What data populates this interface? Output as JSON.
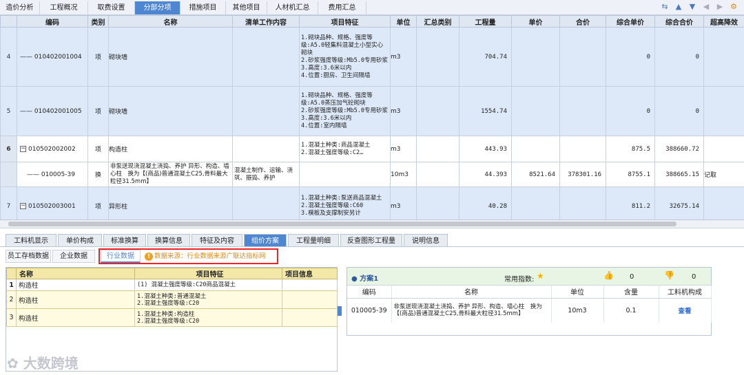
{
  "top_tabs": [
    {
      "label": "造价分析"
    },
    {
      "label": "工程概况"
    },
    {
      "label": "取费设置"
    },
    {
      "label": "分部分项",
      "active": true
    },
    {
      "label": "措施项目"
    },
    {
      "label": "其他项目"
    },
    {
      "label": "人材机汇总"
    },
    {
      "label": "费用汇总"
    }
  ],
  "columns": [
    "编码",
    "类别",
    "名称",
    "清单工作内容",
    "项目特征",
    "单位",
    "汇总类别",
    "工程量",
    "单价",
    "合价",
    "综合单价",
    "综合合价",
    "超高降效"
  ],
  "rows": [
    {
      "no": "4",
      "code": "010402001004",
      "type": "项",
      "name": "砌块墙",
      "work": "",
      "feat": "1.砌块品种、规格、强度等级:A5.0轻集料混凝土小型实心砌块\n2.砂浆强度等级:Mb5.0专用砂浆\n3.高度:3.6米以内\n4.位置:厨房、卫生间隔墙",
      "unit": "m3",
      "qty": "704.74",
      "price": "",
      "total": "",
      "cprice": "0",
      "ctotal": "0",
      "extra": ""
    },
    {
      "no": "5",
      "code": "010402001005",
      "type": "项",
      "name": "砌块墙",
      "work": "",
      "feat": "1.砌块品种、规格、强度等级:A5.0蒸压加气砼砌块\n2.砂浆强度等级:Mb5.0专用砂浆\n3.高度:3.6米以内\n4.位置:室内隔墙",
      "unit": "m3",
      "qty": "1554.74",
      "price": "",
      "total": "",
      "cprice": "0",
      "ctotal": "0",
      "extra": ""
    },
    {
      "no": "6",
      "code": "010502002002",
      "type": "项",
      "name": "构造柱",
      "work": "",
      "feat": "1.混凝土种类:商品混凝土\n2.混凝土强度等级:C2…",
      "unit": "m3",
      "qty": "443.93",
      "price": "",
      "total": "",
      "cprice": "875.5",
      "ctotal": "388660.72",
      "extra": ""
    },
    {
      "no": "",
      "code": "010005-39",
      "type": "换",
      "name": "非泵送现浇混凝土浇捣、养护 异形、构造、墙心柱　换为【(商品)普通混凝土C25,骨料最大粒径31.5mm】",
      "work": "混凝土制作、运输、浇筑、振捣、养护",
      "feat": "",
      "unit": "10m3",
      "qty": "44.393",
      "price": "8521.64",
      "total": "378301.16",
      "cprice": "8755.1",
      "ctotal": "388665.15",
      "extra": "记取"
    },
    {
      "no": "7",
      "code": "010502003001",
      "type": "项",
      "name": "异形柱",
      "work": "",
      "feat": "1.混凝土种类:泵送商品混凝土\n2.混凝土强度等级:C60\n3.模板及支撑制安另计",
      "unit": "m3",
      "qty": "40.28",
      "price": "",
      "total": "",
      "cprice": "811.2",
      "ctotal": "32675.14",
      "extra": ""
    }
  ],
  "bottom_tabs": [
    {
      "label": "工料机显示"
    },
    {
      "label": "单价构成"
    },
    {
      "label": "标准换算"
    },
    {
      "label": "换算信息"
    },
    {
      "label": "特征及内容"
    },
    {
      "label": "组价方案",
      "active": true
    },
    {
      "label": "工程量明细"
    },
    {
      "label": "反查图形工程量"
    },
    {
      "label": "说明信息"
    }
  ],
  "sub_tabs": {
    "employee": "员工存档数据",
    "enterprise": "企业数据",
    "industry": "行业数据",
    "source": "数据来源：行业数据来源广联达指标网"
  },
  "left_table": {
    "headers": [
      "名称",
      "项目特征",
      "项目信息"
    ],
    "rows": [
      {
        "no": "1",
        "name": "构造柱",
        "feat": "(1) 混凝土强度等级:C20商品混凝土"
      },
      {
        "no": "2",
        "name": "构造柱",
        "feat": "1.混凝土种类:普通混凝土\n2.混凝土强度等级:C20"
      },
      {
        "no": "3",
        "name": "构造柱",
        "feat": "1.混凝土种类:构造柱\n2.混凝土强度等级:C20"
      }
    ]
  },
  "scheme": {
    "title": "方案1",
    "common_index": "常用指数:",
    "likes": "0",
    "dislikes": "0",
    "headers": [
      "编码",
      "名称",
      "单位",
      "含量",
      "工料机构成"
    ],
    "row": {
      "code": "010005-39",
      "name": "非泵送现浇混凝土浇捣、养护 异形、构造、墙心柱　换为【(商品)普通混凝土C25,骨料最大粒径31.5mm】",
      "unit": "10m3",
      "qty": "0.1",
      "action": "查看"
    }
  },
  "watermark": "大数跨境",
  "accent_color": "#4f86d2"
}
